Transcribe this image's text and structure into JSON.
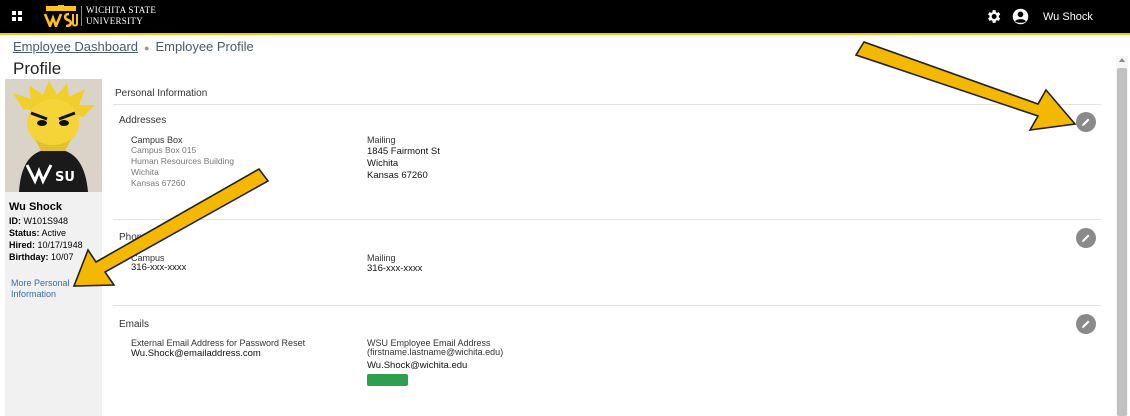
{
  "topbar": {
    "logo_text": "WSU",
    "university_name_line1": "Wichita State",
    "university_name_line2": "University",
    "user_name": "Wu Shock",
    "icons": [
      "apps-grid-icon",
      "gear-icon",
      "user-circle-icon"
    ]
  },
  "breadcrumb": {
    "items": [
      "Employee Dashboard",
      "Employee Profile"
    ]
  },
  "page_title": "Profile",
  "employee": {
    "name": "Wu Shock",
    "id_label": "ID:",
    "id_value": "W101S948",
    "status_label": "Status:",
    "status_value": "Active",
    "hired_label": "Hired:",
    "hired_value": "10/17/1948",
    "birthday_label": "Birthday:",
    "birthday_value": "10/07",
    "more_link": "More Personal Information"
  },
  "personal_info": {
    "title": "Personal Information",
    "addresses": {
      "title": "Addresses",
      "campus_label": "Campus Box",
      "campus_lines": [
        "Campus Box 015",
        "Human Resources Building",
        "Wichita",
        "Kansas 67260"
      ],
      "mailing_label": "Mailing",
      "mailing_lines": [
        "1845 Fairmont St",
        "Wichita",
        "Kansas 67260"
      ]
    },
    "phones": {
      "title": "Phones",
      "campus_label": "Campus",
      "campus_value": "316-xxx-xxxx",
      "mailing_label": "Mailing",
      "mailing_value": "316-xxx-xxxx"
    },
    "emails": {
      "title": "Emails",
      "external_label": "External Email Address for Password Reset",
      "external_value": "Wu.Shock@emailaddress.com",
      "wsu_label": "WSU Employee Email Address",
      "wsu_hint": "(firstname.lastname@wichita.edu)",
      "wsu_value": "Wu.Shock@wichita.edu"
    }
  },
  "colors": {
    "topbar": "#000000",
    "accent_gold": "#ffc217",
    "badge_green": "#2e9e4f",
    "link_blue": "#3a6ea5",
    "arrow_fill": "#f5b800"
  }
}
